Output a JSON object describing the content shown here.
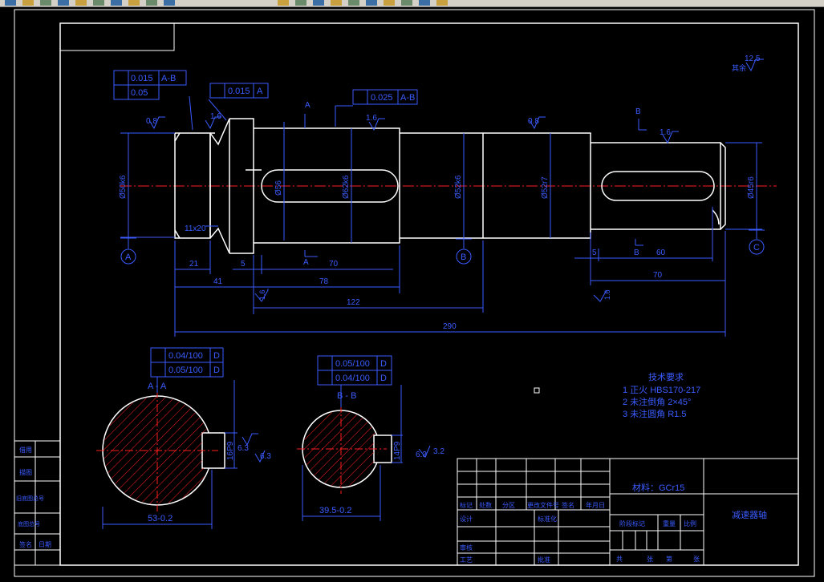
{
  "toolbar": {
    "buttons": [
      "open-icon",
      "save-icon",
      "undo-icon",
      "zoom-realtime-icon",
      "zoom-window-icon",
      "zoom-previous-icon",
      "pan-icon",
      "properties-icon",
      "design-center-icon",
      "tool-palette-icon",
      "sheet-set-icon",
      "markup-icon",
      "calculator-icon",
      "help-icon",
      "layer-icon",
      "layer-state-icon",
      "layer-off-icon",
      "layer-freeze-icon",
      "lineweight-icon",
      "plotstyle-icon"
    ]
  },
  "colors": {
    "outline": "#ffffff",
    "dim": "#3a5cff",
    "center": "#ff2020",
    "hatch": "#ff2020",
    "background": "#000000"
  },
  "drawing": {
    "labels": {
      "section_a_mark": "A",
      "section_b_mark": "B",
      "section_aa_title": "A - A",
      "section_bb_title": "B - B",
      "datum_a": "A",
      "datum_b": "B",
      "datum_c": "C",
      "cut_a_bottom": "A",
      "cut_b_bottom": "B"
    },
    "roughness": {
      "r1": "0.8",
      "r2": "1.6",
      "r3": "1.6",
      "r4": "0.8",
      "r5": "1.6",
      "r6": "12.5",
      "r7": "6.3",
      "r8": "6.3",
      "r9": "6.3",
      "r10": "3.2",
      "r11": "1.6",
      "r12": "1.6",
      "general": "其余"
    },
    "tolerance_frames": {
      "f1_val": "0.015",
      "f1_ref": "A-B",
      "f2_val": "0.05",
      "f3_val": "0.015",
      "f3_ref": "A",
      "f4_val": "0.025",
      "f4_ref": "A-B",
      "f5_val": "0.04/100",
      "f5_ref": "D",
      "f6_val": "0.05/100",
      "f6_ref": "D",
      "f7_val": "0.05/100",
      "f7_ref": "D",
      "f8_val": "0.04/100",
      "f8_ref": "D"
    },
    "diameters": {
      "d1": "Ø50k6",
      "d2": "Ø56",
      "d3": "Ø62k6",
      "d4": "Ø52k6",
      "d5": "Ø52r7",
      "d6": "Ø45r6"
    },
    "dimensions": {
      "chamfer": "11x20",
      "len_21": "21",
      "len_5": "5",
      "len_70a": "70",
      "len_41": "41",
      "len_78": "78",
      "len_122": "122",
      "len_290": "290",
      "len_5b": "5",
      "len_60": "60",
      "len_70b": "70",
      "keyA": "16P9",
      "keyB": "14P9",
      "depthA": "53-0.2",
      "depthB": "39.5-0.2"
    },
    "notes": {
      "title": "技术要求",
      "n1": "1  正火 HBS170-217",
      "n2": "2  未注倒角 2×45°",
      "n3": "3  未注圆角 R1.5"
    },
    "title_block": {
      "material": "材料：GCr15",
      "part_name": "减速器轴",
      "row_labels": [
        "标记",
        "处数",
        "分区",
        "更改文件号",
        "签名",
        "年月日",
        "设计",
        "审核",
        "工艺",
        "批准",
        "标准化"
      ],
      "right_labels": [
        "阶段标记",
        "重量",
        "比例"
      ],
      "bottom_labels": [
        "共",
        "张",
        "第",
        "张"
      ]
    },
    "left_block": [
      "借用",
      "描图",
      "旧底图总号",
      "底图总号",
      "签名",
      "日期"
    ]
  }
}
